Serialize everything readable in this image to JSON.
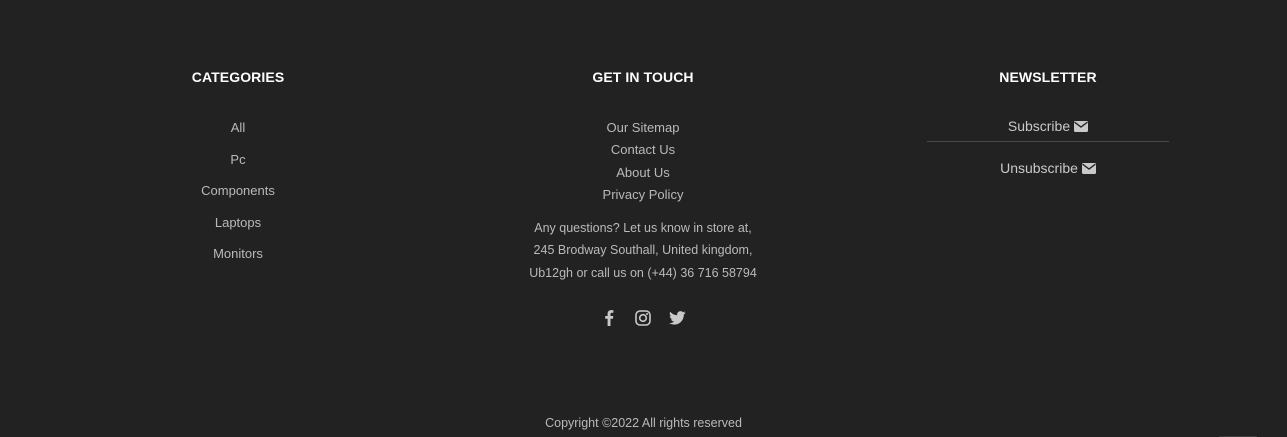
{
  "categories": {
    "heading": "CATEGORIES",
    "items": [
      "All",
      "Pc",
      "Components",
      "Laptops",
      "Monitors"
    ]
  },
  "contact": {
    "heading": "GET IN TOUCH",
    "links": [
      "Our Sitemap",
      "Contact Us",
      "About Us",
      "Privacy Policy"
    ],
    "address_lines": [
      "Any questions? Let us know in store at,",
      "245 Brodway Southall, United kingdom,",
      "Ub12gh or call us on (+44) 36 716 58794"
    ],
    "social_icons": [
      "facebook-icon",
      "instagram-icon",
      "twitter-icon"
    ]
  },
  "newsletter": {
    "heading": "NEWSLETTER",
    "subscribe_label": "Subscribe",
    "unsubscribe_label": "Unsubscribe",
    "icon": "envelope-icon"
  },
  "footer": {
    "copyright": "Copyright ©2022 All rights reserved"
  },
  "colors": {
    "background": "#222222",
    "heading": "#ffffff",
    "text": "#b9b9b9"
  }
}
